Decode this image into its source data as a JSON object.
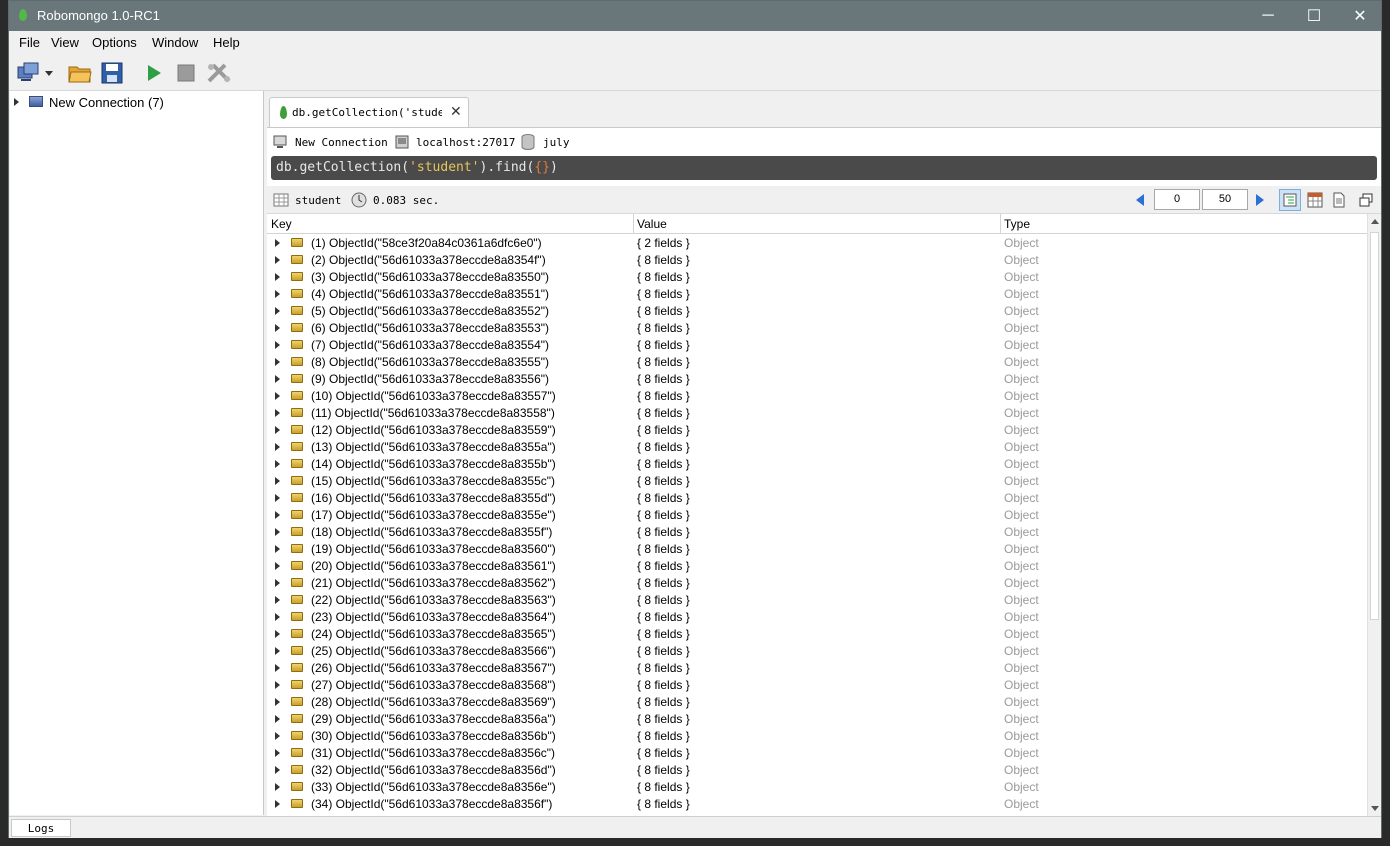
{
  "window": {
    "title": "Robomongo 1.0-RC1",
    "minimize": "─",
    "maximize": "☐",
    "close": "✕"
  },
  "menu": [
    "File",
    "View",
    "Options",
    "Window",
    "Help"
  ],
  "sidebar": {
    "connection_label": "New Connection (7)"
  },
  "tab": {
    "label": "db.getCollection('studen…",
    "close": "✕"
  },
  "breadcrumb": {
    "connection": "New Connection",
    "host": "localhost:27017",
    "database": "july"
  },
  "query": {
    "prefix": "db.getCollection(",
    "string": "'student'",
    "middle": ").find(",
    "braces": "{}",
    "suffix": ")"
  },
  "results": {
    "collection": "student",
    "time": "0.083 sec.",
    "skip": "0",
    "limit": "50"
  },
  "columns": {
    "key": "Key",
    "value": "Value",
    "type": "Type"
  },
  "rows": [
    {
      "key": "(1) ObjectId(\"58ce3f20a84c0361a6dfc6e0\")",
      "value": "{ 2 fields }",
      "type": "Object"
    },
    {
      "key": "(2) ObjectId(\"56d61033a378eccde8a8354f\")",
      "value": "{ 8 fields }",
      "type": "Object"
    },
    {
      "key": "(3) ObjectId(\"56d61033a378eccde8a83550\")",
      "value": "{ 8 fields }",
      "type": "Object"
    },
    {
      "key": "(4) ObjectId(\"56d61033a378eccde8a83551\")",
      "value": "{ 8 fields }",
      "type": "Object"
    },
    {
      "key": "(5) ObjectId(\"56d61033a378eccde8a83552\")",
      "value": "{ 8 fields }",
      "type": "Object"
    },
    {
      "key": "(6) ObjectId(\"56d61033a378eccde8a83553\")",
      "value": "{ 8 fields }",
      "type": "Object"
    },
    {
      "key": "(7) ObjectId(\"56d61033a378eccde8a83554\")",
      "value": "{ 8 fields }",
      "type": "Object"
    },
    {
      "key": "(8) ObjectId(\"56d61033a378eccde8a83555\")",
      "value": "{ 8 fields }",
      "type": "Object"
    },
    {
      "key": "(9) ObjectId(\"56d61033a378eccde8a83556\")",
      "value": "{ 8 fields }",
      "type": "Object"
    },
    {
      "key": "(10) ObjectId(\"56d61033a378eccde8a83557\")",
      "value": "{ 8 fields }",
      "type": "Object"
    },
    {
      "key": "(11) ObjectId(\"56d61033a378eccde8a83558\")",
      "value": "{ 8 fields }",
      "type": "Object"
    },
    {
      "key": "(12) ObjectId(\"56d61033a378eccde8a83559\")",
      "value": "{ 8 fields }",
      "type": "Object"
    },
    {
      "key": "(13) ObjectId(\"56d61033a378eccde8a8355a\")",
      "value": "{ 8 fields }",
      "type": "Object"
    },
    {
      "key": "(14) ObjectId(\"56d61033a378eccde8a8355b\")",
      "value": "{ 8 fields }",
      "type": "Object"
    },
    {
      "key": "(15) ObjectId(\"56d61033a378eccde8a8355c\")",
      "value": "{ 8 fields }",
      "type": "Object"
    },
    {
      "key": "(16) ObjectId(\"56d61033a378eccde8a8355d\")",
      "value": "{ 8 fields }",
      "type": "Object"
    },
    {
      "key": "(17) ObjectId(\"56d61033a378eccde8a8355e\")",
      "value": "{ 8 fields }",
      "type": "Object"
    },
    {
      "key": "(18) ObjectId(\"56d61033a378eccde8a8355f\")",
      "value": "{ 8 fields }",
      "type": "Object"
    },
    {
      "key": "(19) ObjectId(\"56d61033a378eccde8a83560\")",
      "value": "{ 8 fields }",
      "type": "Object"
    },
    {
      "key": "(20) ObjectId(\"56d61033a378eccde8a83561\")",
      "value": "{ 8 fields }",
      "type": "Object"
    },
    {
      "key": "(21) ObjectId(\"56d61033a378eccde8a83562\")",
      "value": "{ 8 fields }",
      "type": "Object"
    },
    {
      "key": "(22) ObjectId(\"56d61033a378eccde8a83563\")",
      "value": "{ 8 fields }",
      "type": "Object"
    },
    {
      "key": "(23) ObjectId(\"56d61033a378eccde8a83564\")",
      "value": "{ 8 fields }",
      "type": "Object"
    },
    {
      "key": "(24) ObjectId(\"56d61033a378eccde8a83565\")",
      "value": "{ 8 fields }",
      "type": "Object"
    },
    {
      "key": "(25) ObjectId(\"56d61033a378eccde8a83566\")",
      "value": "{ 8 fields }",
      "type": "Object"
    },
    {
      "key": "(26) ObjectId(\"56d61033a378eccde8a83567\")",
      "value": "{ 8 fields }",
      "type": "Object"
    },
    {
      "key": "(27) ObjectId(\"56d61033a378eccde8a83568\")",
      "value": "{ 8 fields }",
      "type": "Object"
    },
    {
      "key": "(28) ObjectId(\"56d61033a378eccde8a83569\")",
      "value": "{ 8 fields }",
      "type": "Object"
    },
    {
      "key": "(29) ObjectId(\"56d61033a378eccde8a8356a\")",
      "value": "{ 8 fields }",
      "type": "Object"
    },
    {
      "key": "(30) ObjectId(\"56d61033a378eccde8a8356b\")",
      "value": "{ 8 fields }",
      "type": "Object"
    },
    {
      "key": "(31) ObjectId(\"56d61033a378eccde8a8356c\")",
      "value": "{ 8 fields }",
      "type": "Object"
    },
    {
      "key": "(32) ObjectId(\"56d61033a378eccde8a8356d\")",
      "value": "{ 8 fields }",
      "type": "Object"
    },
    {
      "key": "(33) ObjectId(\"56d61033a378eccde8a8356e\")",
      "value": "{ 8 fields }",
      "type": "Object"
    },
    {
      "key": "(34) ObjectId(\"56d61033a378eccde8a8356f\")",
      "value": "{ 8 fields }",
      "type": "Object"
    }
  ],
  "status": {
    "logs_label": "Logs"
  },
  "icons": {
    "app": "mongodb-leaf-icon",
    "toolbar": [
      "connect-icon",
      "open-folder-icon",
      "save-icon",
      "execute-icon",
      "stop-icon",
      "orchestrate-icon"
    ],
    "views": [
      "tree-view-icon",
      "table-view-icon",
      "text-view-icon"
    ]
  },
  "colors": {
    "titlebar": "#69777a",
    "query_bg": "#4a4a4a",
    "query_string": "#e6c558",
    "query_brace": "#e07a40",
    "accent_green": "#2f9e44",
    "type_text": "#9a9a9a"
  }
}
